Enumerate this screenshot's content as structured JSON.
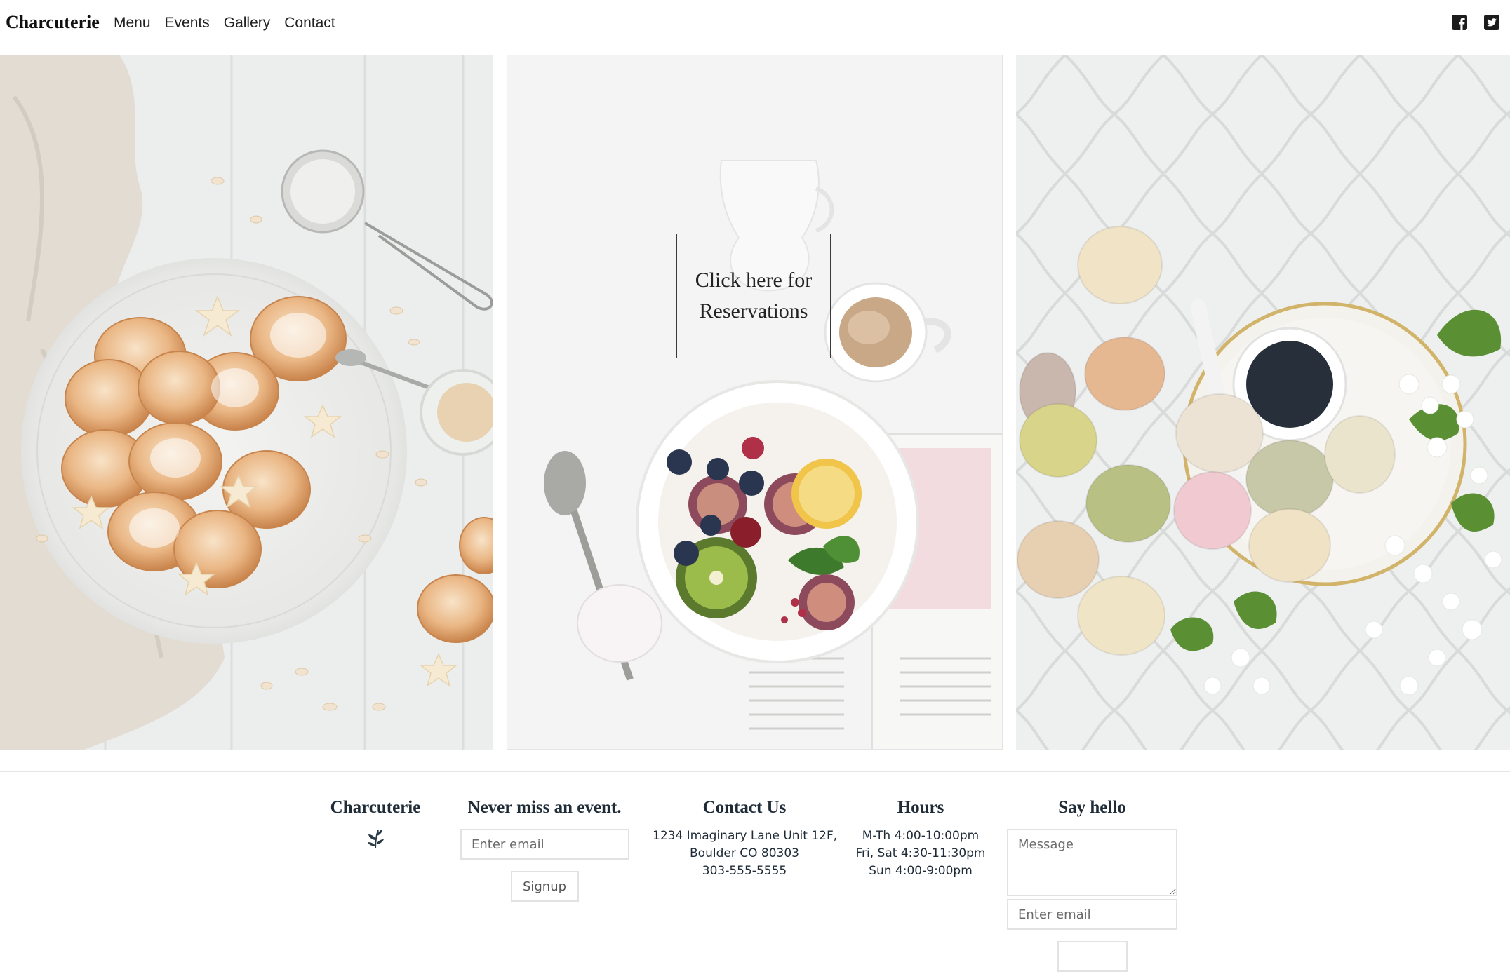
{
  "nav": {
    "brand": "Charcuterie",
    "links": [
      "Menu",
      "Events",
      "Gallery",
      "Contact"
    ],
    "social": [
      {
        "icon": "facebook-square-icon"
      },
      {
        "icon": "twitter-square-icon"
      }
    ]
  },
  "hero": {
    "reservation_line1": "Click here for",
    "reservation_line2": "Reservations"
  },
  "footer": {
    "brand": {
      "title": "Charcuterie",
      "icon": "leaf-sprig-icon"
    },
    "newsletter": {
      "title": "Never miss an event.",
      "email_placeholder": "Enter email",
      "signup_label": "Signup"
    },
    "contact": {
      "title": "Contact Us",
      "address_line1": "1234 Imaginary Lane Unit 12F,",
      "address_line2": "Boulder CO 80303",
      "phone": "303-555-5555"
    },
    "hours": {
      "title": "Hours",
      "line1": "M-Th 4:00-10:00pm",
      "line2": "Fri, Sat 4:30-11:30pm",
      "line3": "Sun 4:00-9:00pm"
    },
    "say_hello": {
      "title": "Say hello",
      "message_placeholder": "Message",
      "email_placeholder": "Enter email"
    }
  },
  "colors": {
    "text_dark": "#1f2c38",
    "border_light": "#e2e2e2"
  }
}
